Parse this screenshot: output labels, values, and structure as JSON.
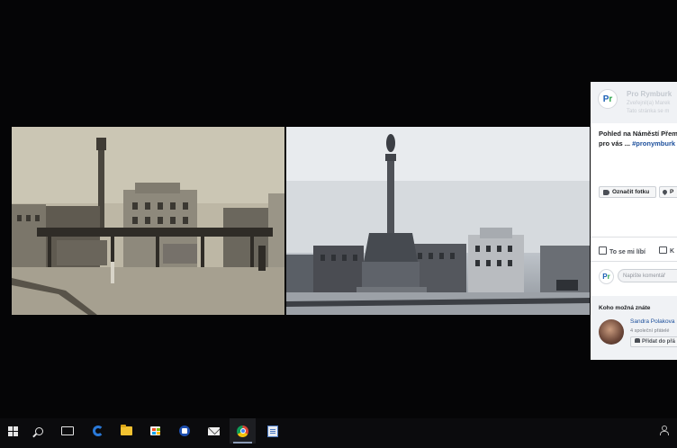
{
  "facebook_panel": {
    "page_name": "Pro Rymburk",
    "page_sub_1": "Zveřejnil(a) Marek",
    "page_sub_2": "Tato stránka se m",
    "post_line_1": "Pohled na Náměstí Přemy",
    "post_line_2_prefix": "pro vás ...",
    "post_line_2_hashtag": "#pronymburk",
    "tag_button": "Označit fotku",
    "location_button": "P",
    "like_label": "To se mi líbí",
    "comment_label": "K",
    "comment_placeholder": "Napište komentář",
    "pymk_title": "Koho možná znáte",
    "pymk_person_name": "Sandra Polakova",
    "pymk_person_sub": "4 společní přátelé",
    "pymk_add_button": "Přidat do přá"
  },
  "photos": {
    "left": "historic-square-photo",
    "right": "modern-square-photo"
  },
  "taskbar": {
    "icons": [
      "windows-start-icon",
      "search-icon",
      "task-view-icon",
      "edge-icon",
      "file-explorer-icon",
      "store-icon",
      "app-icon",
      "mail-icon",
      "chrome-icon",
      "document-app-icon",
      "people-icon"
    ],
    "active": "chrome-icon",
    "accent": "#8a9ab5"
  }
}
